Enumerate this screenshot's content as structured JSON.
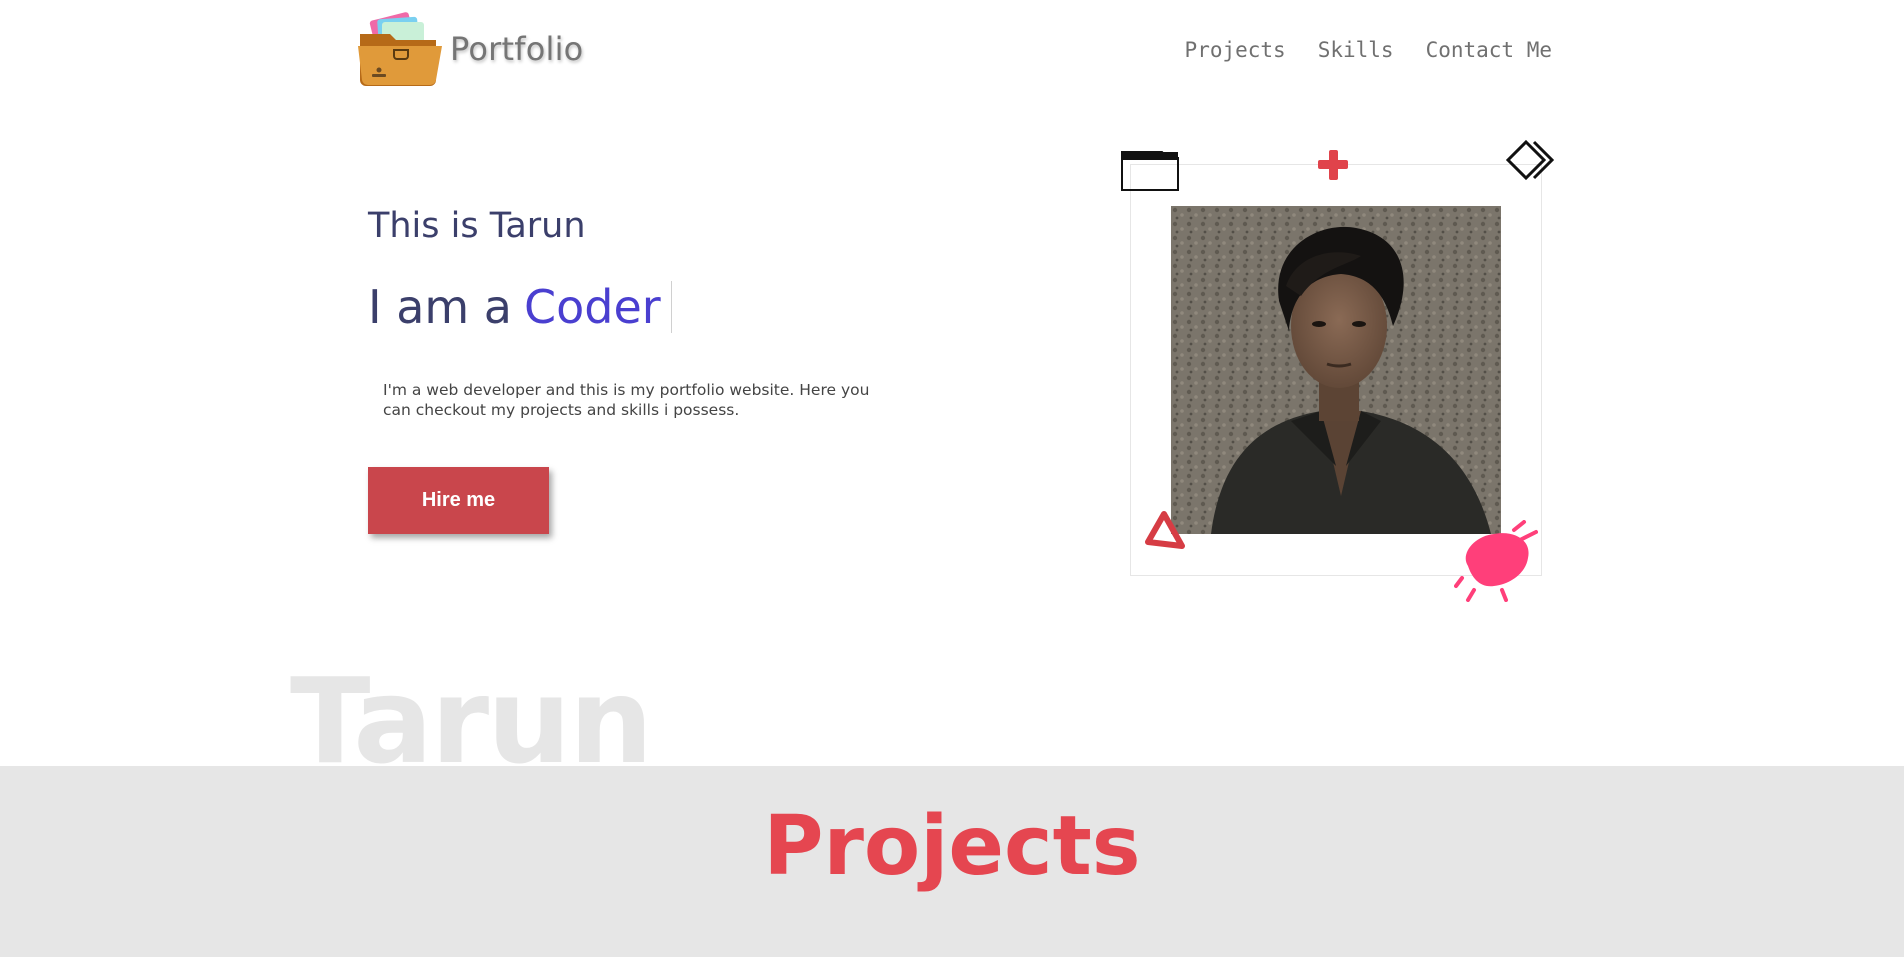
{
  "nav": {
    "logo_text": "Portfolio",
    "links": [
      "Projects",
      "Skills",
      "Contact Me"
    ]
  },
  "hero": {
    "greeting": "This is Tarun",
    "role_prefix": "I am a",
    "role_word": "Coder",
    "intro": "I'm a web developer and this is my portfolio website. Here you can checkout my projects and skills i possess.",
    "hire_label": "Hire me"
  },
  "watermark": "Tarun",
  "projects": {
    "title": "Projects"
  },
  "colors": {
    "accent_purple": "#4a3fd0",
    "hero_text": "#3b3f6b",
    "button_red": "#c9464c",
    "projects_title": "#e54650",
    "section_bg": "#e6e6e6"
  }
}
